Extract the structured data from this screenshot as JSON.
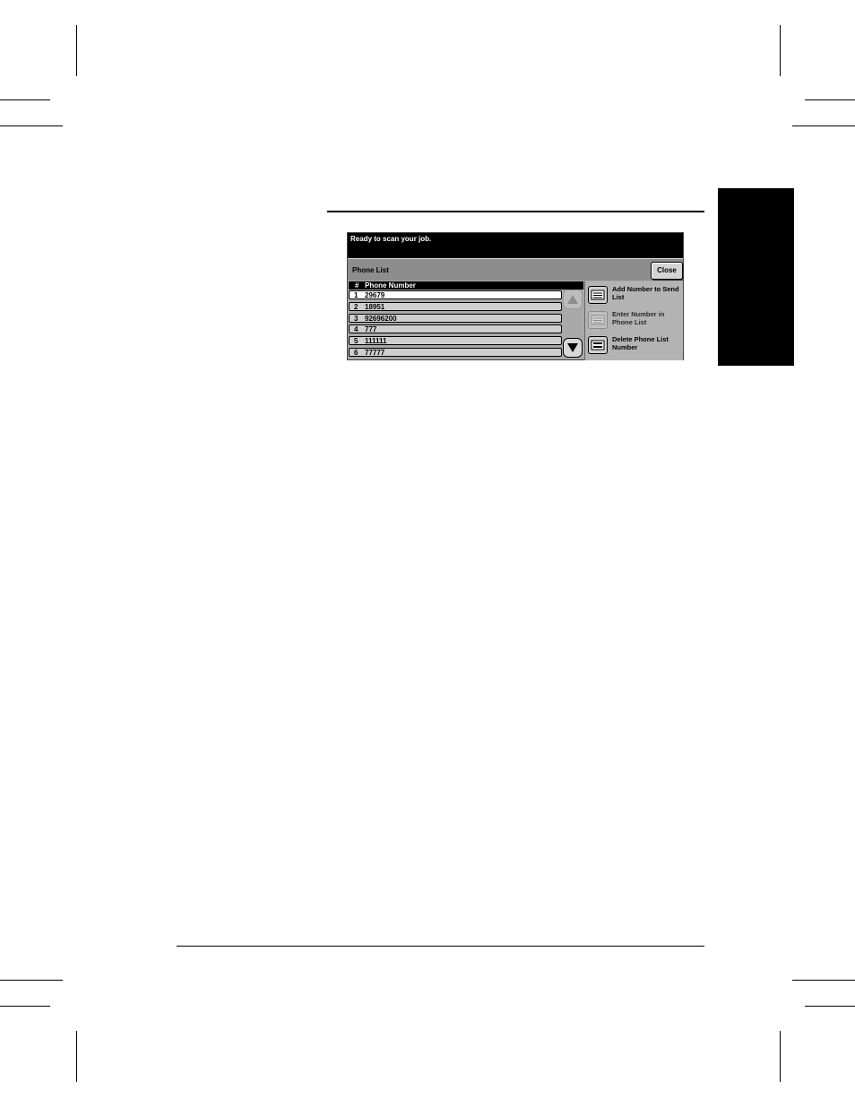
{
  "screen": {
    "message": "Ready to scan your job.",
    "title": "Phone List",
    "close_label": "Close",
    "list": {
      "header_hash": "#",
      "header_number": "Phone Number",
      "rows": [
        {
          "num": "1",
          "value": "29679"
        },
        {
          "num": "2",
          "value": "18951"
        },
        {
          "num": "3",
          "value": "92696200"
        },
        {
          "num": "4",
          "value": "777"
        },
        {
          "num": "5",
          "value": "111111"
        },
        {
          "num": "6",
          "value": "77777"
        }
      ]
    },
    "actions": [
      {
        "label": "Add Number to Send List",
        "icon": "list-add-icon"
      },
      {
        "label": "Enter Number in Phone List",
        "icon": "keypad-icon"
      },
      {
        "label": "Delete Phone List Number",
        "icon": "delete-list-icon"
      }
    ]
  }
}
